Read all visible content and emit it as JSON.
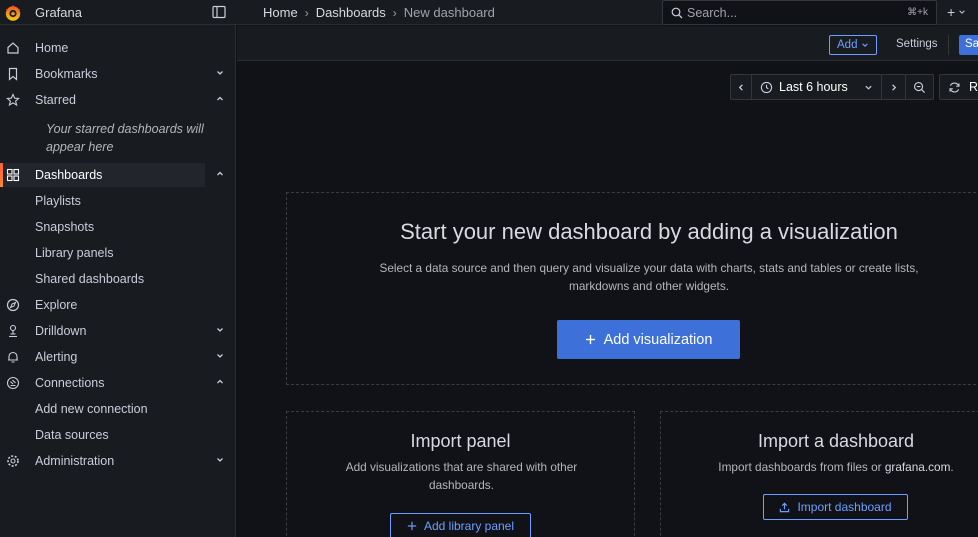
{
  "topbar": {
    "brand": "Grafana",
    "breadcrumb": [
      "Home",
      "Dashboards",
      "New dashboard"
    ],
    "search_placeholder": "Search...",
    "search_shortcut": "⌘+k",
    "plus_label": "+"
  },
  "sidebar": {
    "items": [
      {
        "label": "Home",
        "icon": "home-icon"
      },
      {
        "label": "Bookmarks",
        "icon": "bookmark-icon",
        "chevron": "down"
      },
      {
        "label": "Starred",
        "icon": "star-icon",
        "chevron": "up"
      },
      {
        "label": "Dashboards",
        "icon": "apps-icon",
        "chevron": "up",
        "active": true
      },
      {
        "label": "Playlists"
      },
      {
        "label": "Snapshots"
      },
      {
        "label": "Library panels"
      },
      {
        "label": "Shared dashboards"
      },
      {
        "label": "Explore",
        "icon": "compass-icon"
      },
      {
        "label": "Drilldown",
        "icon": "drilldown-icon",
        "chevron": "down"
      },
      {
        "label": "Alerting",
        "icon": "bell-icon",
        "chevron": "down"
      },
      {
        "label": "Connections",
        "icon": "connections-icon",
        "chevron": "up"
      },
      {
        "label": "Add new connection"
      },
      {
        "label": "Data sources"
      },
      {
        "label": "Administration",
        "icon": "cog-icon",
        "chevron": "down"
      }
    ],
    "starred_empty": "Your starred dashboards will appear here"
  },
  "toolbar": {
    "add_label": "Add",
    "settings_label": "Settings",
    "save_label": "Sa"
  },
  "time": {
    "range_label": "Last 6 hours",
    "refresh_label": "Re"
  },
  "empty": {
    "title": "Start your new dashboard by adding a visualization",
    "description": "Select a data source and then query and visualize your data with charts, stats and tables or create lists, markdowns and other widgets.",
    "add_visualization": "Add visualization"
  },
  "import_panel": {
    "title": "Import panel",
    "description": "Add visualizations that are shared with other dashboards.",
    "button": "Add library panel"
  },
  "import_dashboard": {
    "title": "Import a dashboard",
    "description_prefix": "Import dashboards from files or ",
    "description_link": "grafana.com",
    "description_suffix": ".",
    "button": "Import dashboard"
  },
  "colors": {
    "background": "#111217",
    "panel": "#181b1f",
    "primary": "#3d71d9",
    "primary_text": "#6e9fff",
    "brand_orange": "#f55f3e"
  }
}
